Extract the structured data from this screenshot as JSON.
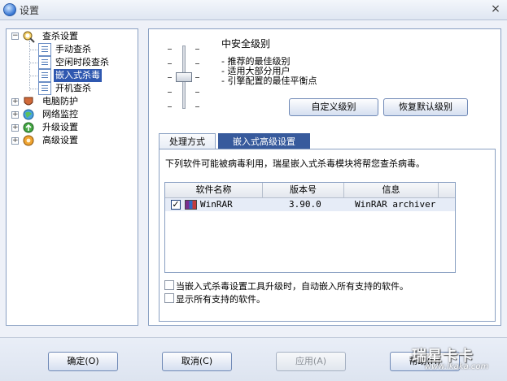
{
  "window": {
    "title": "设置",
    "close_glyph": "×"
  },
  "tree": {
    "root": "查杀设置",
    "children": [
      "手动查杀",
      "空闲时段查杀",
      "嵌入式杀毒",
      "开机查杀"
    ],
    "others": [
      "电脑防护",
      "网络监控",
      "升级设置",
      "高级设置"
    ]
  },
  "level": {
    "title": "中安全级别",
    "bullets": [
      "- 推荐的最佳级别",
      "- 适用大部分用户",
      "- 引擎配置的最佳平衡点"
    ],
    "custom_button": "自定义级别",
    "restore_button": "恢复默认级别"
  },
  "tabs": [
    "处理方式",
    "嵌入式高级设置"
  ],
  "embedded": {
    "info": "下列软件可能被病毒利用，瑞星嵌入式杀毒模块将帮您查杀病毒。",
    "columns": [
      "软件名称",
      "版本号",
      "信息"
    ],
    "rows": [
      {
        "name": "WinRAR",
        "version": "3.90.0",
        "info": "WinRAR archiver",
        "checked": "✓"
      }
    ],
    "option1": "当嵌入式杀毒设置工具升级时，自动嵌入所有支持的软件。",
    "option2": "显示所有支持的软件。"
  },
  "buttons": {
    "ok": "确定(O)",
    "cancel": "取消(C)",
    "apply": "应用(A)",
    "help": "帮助(H)"
  },
  "watermark": {
    "big": "瑞星卡卡",
    "small": "www.ikaka.com"
  }
}
